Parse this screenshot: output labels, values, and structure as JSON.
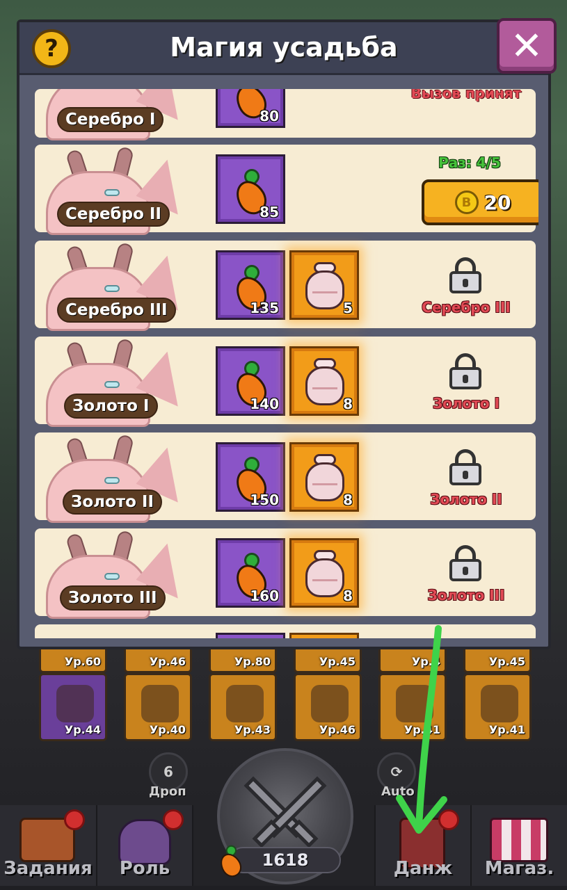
{
  "dialog": {
    "title": "Магия усадьба",
    "help_icon": "question-icon",
    "close_icon": "close-icon"
  },
  "rows": [
    {
      "rank": "Серебро I",
      "reward_carrot": "80",
      "status": "Вызов принят"
    },
    {
      "rank": "Серебро II",
      "reward_carrot": "85",
      "times": "Раз: 4/5",
      "price": "20",
      "coin_symbol": "B"
    },
    {
      "rank": "Серебро III",
      "reward_carrot": "135",
      "reward_pot": "5",
      "requirement": "Серебро III"
    },
    {
      "rank": "Золото I",
      "reward_carrot": "140",
      "reward_pot": "8",
      "requirement": "Золото I"
    },
    {
      "rank": "Золото II",
      "reward_carrot": "150",
      "reward_pot": "8",
      "requirement": "Золото II"
    },
    {
      "rank": "Золото III",
      "reward_carrot": "160",
      "reward_pot": "8",
      "requirement": "Золото III"
    }
  ],
  "equipment": {
    "top_levels": [
      "Ур.60",
      "Ур.46",
      "Ур.80",
      "Ур.45",
      "Ур.4",
      "Ур.45"
    ],
    "bottom_levels": [
      "Ур.44",
      "Ур.40",
      "Ур.43",
      "Ур.46",
      "Ур.41",
      "Ур.41"
    ]
  },
  "controls": {
    "drop_count": "6",
    "drop_label": "Дроп",
    "auto_label": "Auto",
    "power": "1618"
  },
  "nav": {
    "tasks": "Задания",
    "role": "Роль",
    "dungeon": "Данж",
    "shop": "Магаз."
  },
  "colors": {
    "accent_green_arrow": "#3fd34a",
    "locked_text": "#e24a55",
    "times_text": "#46c23b"
  }
}
